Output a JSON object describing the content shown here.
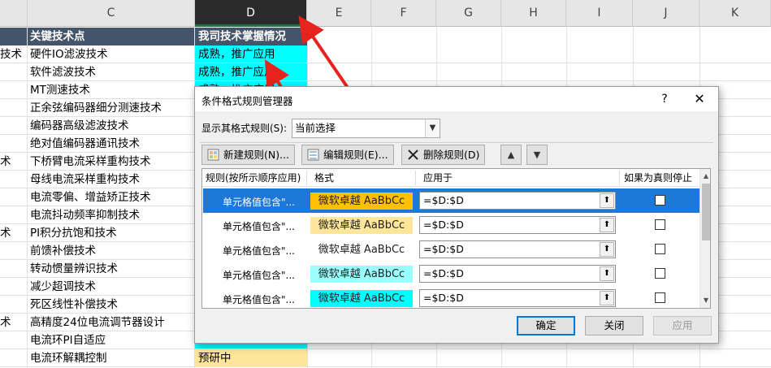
{
  "sheet": {
    "columns": [
      "C",
      "D",
      "E",
      "F",
      "G",
      "H",
      "I",
      "J",
      "K"
    ],
    "header": {
      "c": "关键技术点",
      "d": "我司技术掌握情况"
    },
    "rows": [
      {
        "a": "技术",
        "c": "硬件IO滤波技术",
        "d": "成熟，推广应用",
        "d_color": "#00ffff"
      },
      {
        "a": "",
        "c": "软件滤波技术",
        "d": "成熟，推广应用",
        "d_color": "#00ffff"
      },
      {
        "a": "",
        "c": "MT测速技术",
        "d": "成熟，推广应用",
        "d_color": "#00ffff"
      },
      {
        "a": "",
        "c": "正余弦编码器细分测速技术",
        "d": "",
        "d_color": "#ffffff"
      },
      {
        "a": "",
        "c": "编码器高级滤波技术",
        "d": "",
        "d_color": "#ffffff"
      },
      {
        "a": "",
        "c": "绝对值编码器通讯技术",
        "d": "",
        "d_color": "#ffffff"
      },
      {
        "a": "术",
        "c": "下桥臂电流采样重构技术",
        "d": "",
        "d_color": "#ffffff"
      },
      {
        "a": "",
        "c": "母线电流采样重构技术",
        "d": "",
        "d_color": "#ffffff"
      },
      {
        "a": "",
        "c": "电流零偏、增益矫正技术",
        "d": "",
        "d_color": "#ffffff"
      },
      {
        "a": "",
        "c": "电流抖动频率抑制技术",
        "d": "",
        "d_color": "#ffffff"
      },
      {
        "a": "术",
        "c": "PI积分抗饱和技术",
        "d": "",
        "d_color": "#ffffff"
      },
      {
        "a": "",
        "c": "前馈补偿技术",
        "d": "",
        "d_color": "#ffffff"
      },
      {
        "a": "",
        "c": "转动惯量辨识技术",
        "d": "",
        "d_color": "#ffffff"
      },
      {
        "a": "",
        "c": "减少超调技术",
        "d": "",
        "d_color": "#ffffff"
      },
      {
        "a": "",
        "c": "死区线性补偿技术",
        "d": "",
        "d_color": "#ffffff"
      },
      {
        "a": "术",
        "c": "高精度24位电流调节器设计",
        "d": "",
        "d_color": "#ffffff"
      },
      {
        "a": "",
        "c": "电流环PI自适应",
        "d": "",
        "d_color": "#00ffff"
      },
      {
        "a": "",
        "c": "电流环解耦控制",
        "d": "预研中",
        "d_color": "#ffe699"
      }
    ]
  },
  "dialog": {
    "title": "条件格式规则管理器",
    "help": "?",
    "close": "✕",
    "show_label": "显示其格式规则(S):",
    "show_value": "当前选择",
    "buttons": {
      "new_rule": "新建规则(N)...",
      "edit_rule": "编辑规则(E)...",
      "delete_rule": "删除规则(D)",
      "up": "▲",
      "down": "▼"
    },
    "columns": {
      "rule": "规则(按所示顺序应用)",
      "format": "格式",
      "applies_to": "应用于",
      "stop_if_true": "如果为真则停止"
    },
    "rules": [
      {
        "rule": "单元格值包含\"...",
        "format": "微软卓越  AaBbCc",
        "format_bg": "#ffc000",
        "applies_to": "=$D:$D",
        "selected": true
      },
      {
        "rule": "单元格值包含\"...",
        "format": "微软卓越  AaBbCc",
        "format_bg": "#ffe699",
        "applies_to": "=$D:$D",
        "selected": false
      },
      {
        "rule": "单元格值包含\"...",
        "format": "微软卓越  AaBbCc",
        "format_bg": "#ffffff",
        "applies_to": "=$D:$D",
        "selected": false
      },
      {
        "rule": "单元格值包含\"...",
        "format": "微软卓越  AaBbCc",
        "format_bg": "#99ffff",
        "applies_to": "=$D:$D",
        "selected": false
      },
      {
        "rule": "单元格值包含\"...",
        "format": "微软卓越  AaBbCc",
        "format_bg": "#00ffff",
        "applies_to": "=$D:$D",
        "selected": false
      }
    ],
    "ok": "确定",
    "close_btn": "关闭",
    "apply": "应用"
  },
  "colors": {
    "header_bg": "#44546a",
    "selection_blue": "#1e78d7",
    "arrow_red": "#e8231e"
  }
}
